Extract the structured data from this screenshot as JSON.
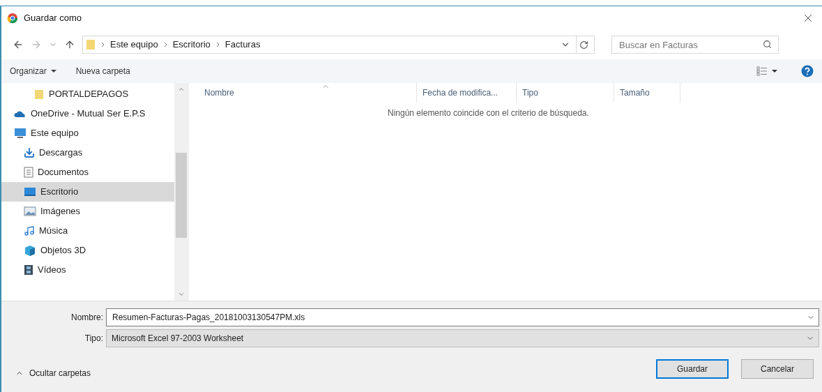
{
  "window": {
    "title": "Guardar como"
  },
  "address_bar": {
    "path": [
      "Este equipo",
      "Escritorio",
      "Facturas"
    ]
  },
  "search": {
    "placeholder": "Buscar en Facturas"
  },
  "toolbar": {
    "organize": "Organizar",
    "new_folder": "Nueva carpeta"
  },
  "sidebar": {
    "items": [
      {
        "label": "PORTALDEPAGOS",
        "kind": "folder",
        "selected": false
      },
      {
        "label": "OneDrive - Mutual Ser E.P.S",
        "kind": "cloud",
        "selected": false
      },
      {
        "label": "Este equipo",
        "kind": "computer",
        "selected": false,
        "children": [
          {
            "label": "Descargas",
            "kind": "download",
            "selected": false
          },
          {
            "label": "Documentos",
            "kind": "document",
            "selected": false
          },
          {
            "label": "Escritorio",
            "kind": "desktop",
            "selected": true
          },
          {
            "label": "Imágenes",
            "kind": "pictures",
            "selected": false
          },
          {
            "label": "Música",
            "kind": "music",
            "selected": false
          },
          {
            "label": "Objetos 3D",
            "kind": "cube",
            "selected": false
          },
          {
            "label": "Vídeos",
            "kind": "video",
            "selected": false
          }
        ]
      }
    ]
  },
  "file_list": {
    "columns": [
      "Nombre",
      "Fecha de modifica...",
      "Tipo",
      "Tamaño"
    ],
    "empty_message": "Ningún elemento coincide con el criterio de búsqueda."
  },
  "form": {
    "name_label": "Nombre:",
    "name_value": "Resumen-Facturas-Pagas_20181003130547PM.xls",
    "type_label": "Tipo:",
    "type_value": "Microsoft Excel 97-2003 Worksheet"
  },
  "footer": {
    "hide_folders": "Ocultar carpetas",
    "buttons": [
      {
        "label": "Guardar",
        "kind": "primary"
      },
      {
        "label": "Cancelar",
        "kind": "secondary"
      }
    ]
  }
}
